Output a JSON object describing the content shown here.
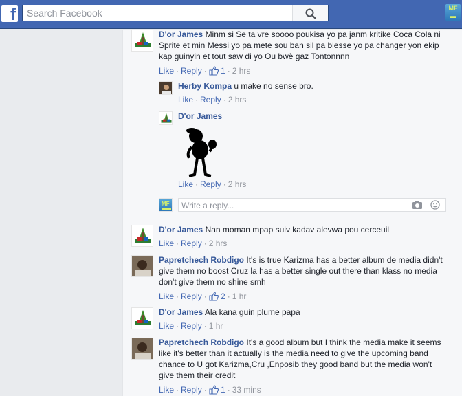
{
  "header": {
    "logo": "f",
    "search_placeholder": "Search Facebook",
    "app_badge": "MF"
  },
  "composer": {
    "placeholder": "Write a reply..."
  },
  "comments": [
    {
      "author": "D'or James",
      "text": "Minm si Se ta vre soooo poukisa yo pa janm kritike Coca Cola ni Sprite et min Messi yo pa mete sou ban sil pa blesse yo pa changer yon ekip kap guinyin et tout saw di yo Ou bwè gaz Tontonnnn",
      "like": "Like",
      "reply": "Reply",
      "likes": "1",
      "time": "2 hrs"
    },
    {
      "author": "Herby Kompa",
      "text": "u make no sense bro.",
      "like": "Like",
      "reply": "Reply",
      "time": "2 hrs"
    },
    {
      "author": "D'or James",
      "text": "",
      "like": "Like",
      "reply": "Reply",
      "time": "2 hrs"
    },
    {
      "author": "D'or James",
      "text": "Nan moman mpap suiv kadav alevwa pou cerceuil",
      "like": "Like",
      "reply": "Reply",
      "time": "2 hrs"
    },
    {
      "author": "Papretchech Robdigo",
      "text": "It's is true Karizma has a better album de media didn't give them no boost Cruz la has a better single out there than klass no media don't give them no shine smh",
      "like": "Like",
      "reply": "Reply",
      "likes": "2",
      "time": "1 hr"
    },
    {
      "author": "D'or James",
      "text": "Ala kana guin plume papa",
      "like": "Like",
      "reply": "Reply",
      "time": "1 hr"
    },
    {
      "author": "Papretchech Robdigo",
      "text": "It's a good album but I think the media make it seems like it's better than it actually is the media need to give the upcoming band chance to U got Karizma,Cru ,Enposib they good band but the media won't give them their credit",
      "like": "Like",
      "reply": "Reply",
      "likes": "1",
      "time": "33 mins"
    }
  ],
  "colors": {
    "brand": "#4267b2",
    "link": "#365899",
    "meta": "#90949c",
    "background": "#f6f7f9"
  }
}
